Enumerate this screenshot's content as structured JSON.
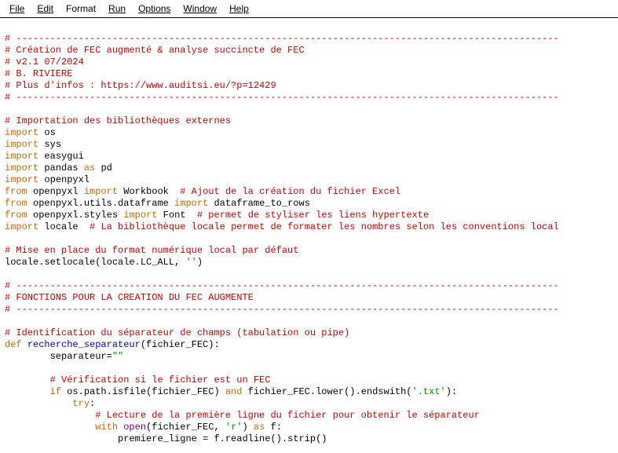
{
  "menu": {
    "file": "File",
    "edit": "Edit",
    "format": "Format",
    "run": "Run",
    "options": "Options",
    "window": "Window",
    "help": "Help"
  },
  "code": {
    "sep1": "# ------------------------------------------------------------------------------------------------",
    "c1": "# Création de FEC augmenté & analyse succincte de FEC",
    "c2": "# v2.1 07/2024",
    "c3": "# B. RIVIERE",
    "c4": "# Plus d'infos : https://www.auditsi.eu/?p=12429",
    "sep2": "# ------------------------------------------------------------------------------------------------",
    "c5": "# Importation des bibliothèques externes",
    "kw_import": "import",
    "kw_from": "from",
    "kw_as": "as",
    "kw_def": "def",
    "kw_if": "if",
    "kw_and": "and",
    "kw_try": "try",
    "kw_with": "with",
    "m_os": "os",
    "m_sys": "sys",
    "m_easygui": "easygui",
    "m_pandas": "pandas",
    "a_pd": "pd",
    "m_openpyxl": "openpyxl",
    "m_workbook": "Workbook",
    "c6": "# Ajout de la création du fichier Excel",
    "m_utils_df": "openpyxl.utils.dataframe",
    "m_df2rows": "dataframe_to_rows",
    "m_styles": "openpyxl.styles",
    "m_font": "Font",
    "c7": "# permet de styliser les liens hypertexte",
    "m_locale": "locale",
    "c8": "# La bibliothèque locale permet de formater les nombres selon les conventions local",
    "c9": "# Mise en place du format numérique local par défaut",
    "call_locale": "locale.setlocale(locale.LC_ALL, ",
    "str_empty": "''",
    "paren_close": ")",
    "sep3": "# ------------------------------------------------------------------------------------------------",
    "c10": "# FONCTIONS POUR LA CREATION DU FEC AUGMENTE",
    "sep4": "# ------------------------------------------------------------------------------------------------",
    "c11": "# Identification du séparateur de champs (tabulation ou pipe)",
    "fn_name": "recherche_separateur",
    "param": "(fichier_FEC):",
    "assign1a": "separateur=",
    "str_empty2": "\"\"",
    "c12": "# Vérification si le fichier est un FEC",
    "cond1": "os.path.isfile(fichier_FEC) ",
    "cond2": "fichier_FEC.lower().endswith(",
    "str_txt": "'.txt'",
    "paren_colon": "):",
    "colon": ":",
    "c13": "# Lecture de la première ligne du fichier pour obtenir le séparateur",
    "open_call": "open",
    "open_args": "(fichier_FEC, ",
    "str_r": "'r'",
    "as_f": ") ",
    "f_var": "f:",
    "last": "premiere_ligne = f.readline().strip()"
  }
}
